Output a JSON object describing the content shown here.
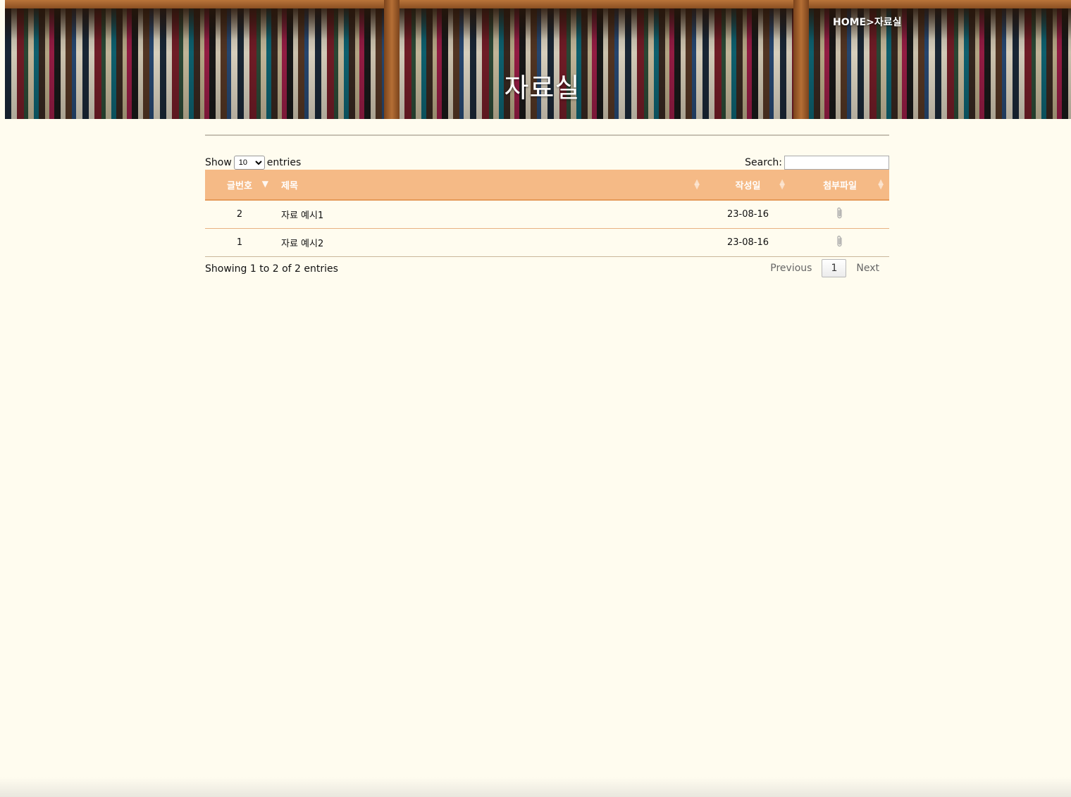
{
  "banner": {
    "title": "자료실",
    "breadcrumb": "HOME>자료실"
  },
  "controls": {
    "show_label": "Show",
    "entries_label": "entries",
    "page_length": "10",
    "page_length_options": [
      "10"
    ],
    "search_label": "Search:",
    "search_value": ""
  },
  "table": {
    "columns": [
      "글번호",
      "제목",
      "작성일",
      "첨부파일"
    ],
    "rows": [
      {
        "no": "2",
        "title": "자료 예시1",
        "date": "23-08-16",
        "file_icon": "paperclip-icon"
      },
      {
        "no": "1",
        "title": "자료 예시2",
        "date": "23-08-16",
        "file_icon": "paperclip-icon"
      }
    ]
  },
  "footer": {
    "info": "Showing 1 to 2 of 2 entries",
    "previous": "Previous",
    "current_page": "1",
    "next": "Next"
  },
  "colors": {
    "page_bg": "#fffcef",
    "header_bg": "#f5ba86",
    "header_text": "#ffffff",
    "row_border": "#e8b183"
  }
}
